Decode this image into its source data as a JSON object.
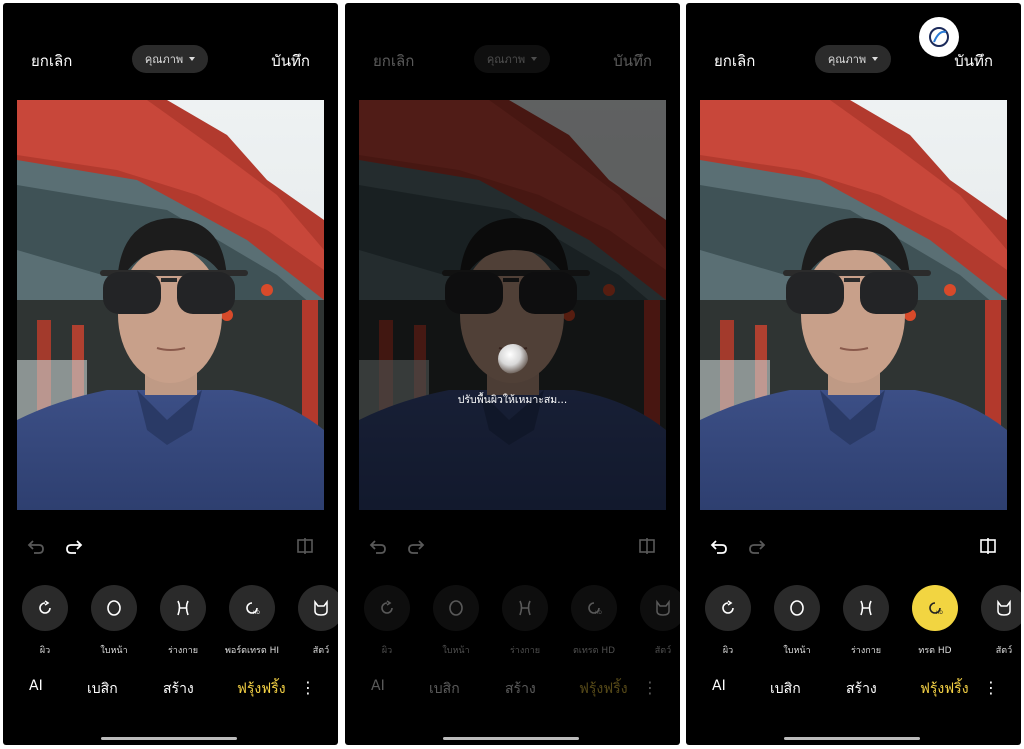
{
  "panels": [
    {
      "cancel": "ยกเลิก",
      "quality": "คุณภาพ",
      "save": "บันทึก",
      "tools": [
        "ผิว",
        "ใบหน้า",
        "ร่างกาย",
        "พอร์ตเทรต HI",
        "สัตว์"
      ],
      "tabs": [
        "AI",
        "เบสิก",
        "สร้าง",
        "ฟรุ้งฟริ้ง"
      ]
    },
    {
      "cancel": "ยกเลิก",
      "quality": "คุณภาพ",
      "save": "บันทึก",
      "loading": "ปรับพื้นผิวให้เหมาะสม...",
      "tools": [
        "ผิว",
        "ใบหน้า",
        "ร่างกาย",
        "ตเทรต HD",
        "สัตว์"
      ],
      "tabs": [
        "AI",
        "เบสิก",
        "สร้าง",
        "ฟรุ้งฟริ้ง"
      ]
    },
    {
      "cancel": "ยกเลิก",
      "quality": "คุณภาพ",
      "save": "บันทึก",
      "tools": [
        "ผิว",
        "ใบหน้า",
        "ร่างกาย",
        "ทรต HD",
        "สัตว์"
      ],
      "tabs": [
        "AI",
        "เบสิก",
        "สร้าง",
        "ฟรุ้งฟริ้ง"
      ]
    }
  ],
  "icons": {
    "undo": "undo-icon",
    "redo": "redo-icon",
    "compare": "compare-icon",
    "more": "more-vertical-icon"
  },
  "colors": {
    "accent": "#f2d541",
    "background": "#000000"
  }
}
